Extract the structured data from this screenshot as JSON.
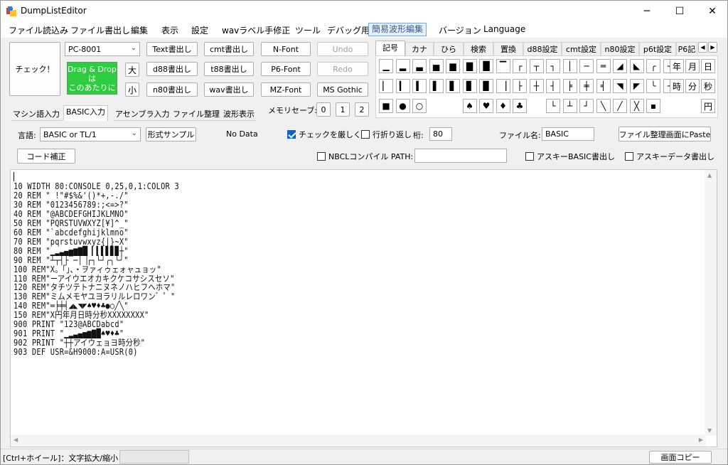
{
  "window": {
    "title": "DumpListEditor",
    "minimize": "─",
    "maximize": "☐",
    "close": "✕"
  },
  "menu": [
    "ファイル読込み",
    "ファイル書出し",
    "編集",
    "表示",
    "設定",
    "wavラベル手修正",
    "ツール",
    "デバッグ用",
    "簡易波形編集",
    "バージョン",
    "Language"
  ],
  "left": {
    "check_button": "チェック！",
    "machine_select": "PC-8001",
    "drag_drop": [
      "Drag & Drop",
      "は",
      "このあたりに"
    ],
    "big": "大",
    "small": "小",
    "buttons": [
      "Text書出し",
      "cmt書出し",
      "N-Font",
      "Undo",
      "d88書出し",
      "t88書出し",
      "P6-Font",
      "Redo",
      "n80書出し",
      "wav書出し",
      "MZ-Font",
      "MS Gothic"
    ],
    "memory_save_label": "メモリセーブ:",
    "memory_slots": [
      "0",
      "1",
      "2"
    ]
  },
  "tabs": [
    "マシン語入力",
    "BASIC入力",
    "アセンブラ入力",
    "ファイル整理",
    "波形表示"
  ],
  "symbol_tabs": [
    "記号",
    "カナ",
    "ひら",
    "検索",
    "置換",
    "d88設定",
    "cmt設定",
    "n80設定",
    "p6t設定",
    "P6記"
  ],
  "symbol_grid": {
    "row1": [
      "▁",
      "▂",
      "▃",
      "▅",
      "▆",
      "▇",
      "█",
      "▔",
      "┌",
      "┬",
      "┐",
      "│",
      "─",
      "═",
      "◢",
      "◣",
      "╭",
      "╮",
      "年",
      "月",
      "日"
    ],
    "row2": [
      "▏",
      "▎",
      "▍",
      "▌",
      "▋",
      "▊",
      "▉",
      "▕",
      "├",
      "┼",
      "┤",
      "╞",
      "╪",
      "╡",
      "◥",
      "◤",
      "╰",
      "╯",
      "時",
      "分",
      "秒"
    ],
    "row3": [
      "■",
      "●",
      "○",
      "",
      "",
      "♠",
      "♥",
      "♦",
      "♣",
      "",
      "└",
      "┴",
      "┘",
      "╲",
      "╱",
      "╳",
      "▪",
      "",
      "",
      "",
      "円"
    ]
  },
  "options": {
    "language_label": "言語:",
    "language_value": "BASIC or TL/1",
    "format_sample": "形式サンプル",
    "no_data": "No Data",
    "strict_check": "チェックを厳しく",
    "wrap": "行折り返し",
    "digits_label": "桁:",
    "digits_value": "80",
    "filename_label": "ファイル名:",
    "filename_value": "BASIC",
    "paste_button": "ファイル整理画面にPaste",
    "code_fix": "コード補正",
    "nbcl": "NBCLコンパイル PATH:",
    "ascii_basic": "アスキーBASIC書出し",
    "ascii_data": "アスキーデータ書出し"
  },
  "code_lines": [
    "10 WIDTH 80:CONSOLE 0,25,0,1:COLOR 3",
    "20 REM \" !\"#$%&'()*+,-./\"",
    "30 REM \"0123456789:;<=>?\"",
    "40 REM \"@ABCDEFGHIJKLMNO\"",
    "50 REM \"PQRSTUVWXYZ[¥]^_\"",
    "60 REM \"`abcdefghijklmno\"",
    "70 REM \"pqrstuvwxyz{|}~X\"",
    "80 REM \"▁▂▃▄▅▆▇█▏▎▍▌▋▊▉┼\"",
    "90 REM \"┴┬┤├▔─│▕┌┐└┘╭╮╰╯\"",
    "100 REM\"X。「」、・ヲァィゥェォャュョッ\"",
    "110 REM\"ーアイウエオカキクケコサシスセソ\"",
    "120 REM\"タチツテトナニヌネノハヒフヘホマ\"",
    "130 REM\"ミムメモヤユヨラリルレロワン゛゜\"",
    "140 REM\"═╞╪╡◢◣◥◤♠♥♦♣●○╱╲\"",
    "150 REM\"X円年月日時分秒XXXXXXXX\"",
    "900 PRINT \"123@ABCDabcd\"",
    "901 PRINT \"▁▂▃▄▅▆▇█♠♥♦♣\"",
    "902 PRINT \"┼┼アイウェョヨ時分秒\"",
    "903 DEF USR=&H9000:A=USR(0)"
  ],
  "status": {
    "hint": "[Ctrl+ホイール]：文字拡大/縮小",
    "screen_copy": "画面コピー"
  }
}
